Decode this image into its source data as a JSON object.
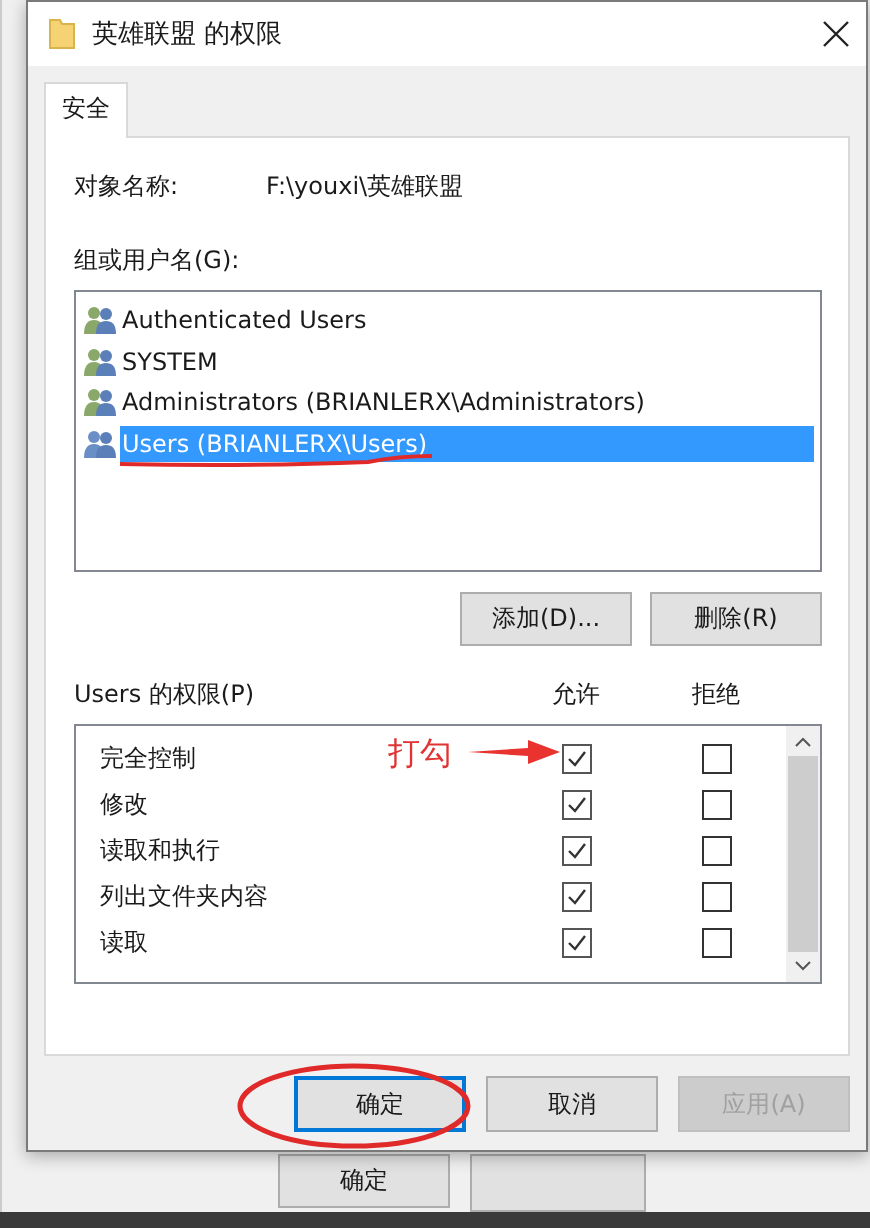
{
  "window": {
    "title": "英雄联盟 的权限"
  },
  "tabs": [
    {
      "label": "安全",
      "selected": true
    }
  ],
  "object_name": {
    "label": "对象名称:",
    "value": "F:\\youxi\\英雄联盟"
  },
  "groups": {
    "label": "组或用户名(G):",
    "items": [
      {
        "name": "Authenticated Users",
        "selected": false
      },
      {
        "name": "SYSTEM",
        "selected": false
      },
      {
        "name": "Administrators (BRIANLERX\\Administrators)",
        "selected": false
      },
      {
        "name": "Users (BRIANLERX\\Users)",
        "selected": true
      }
    ]
  },
  "group_buttons": [
    "添加(D)...",
    "删除(R)"
  ],
  "permissions": {
    "label": "Users 的权限(P)",
    "columns": [
      "允许",
      "拒绝"
    ],
    "rows": [
      {
        "name": "完全控制",
        "allow": true,
        "deny": false
      },
      {
        "name": "修改",
        "allow": true,
        "deny": false
      },
      {
        "name": "读取和执行",
        "allow": true,
        "deny": false
      },
      {
        "name": "列出文件夹内容",
        "allow": true,
        "deny": false
      },
      {
        "name": "读取",
        "allow": true,
        "deny": false
      }
    ]
  },
  "buttons": [
    {
      "label": "确定",
      "default": true,
      "disabled": false
    },
    {
      "label": "取消",
      "default": false,
      "disabled": false
    },
    {
      "label": "应用(A)",
      "default": false,
      "disabled": true
    }
  ],
  "annotation": {
    "text": "打勾"
  },
  "background_buttons": [
    "确定"
  ]
}
